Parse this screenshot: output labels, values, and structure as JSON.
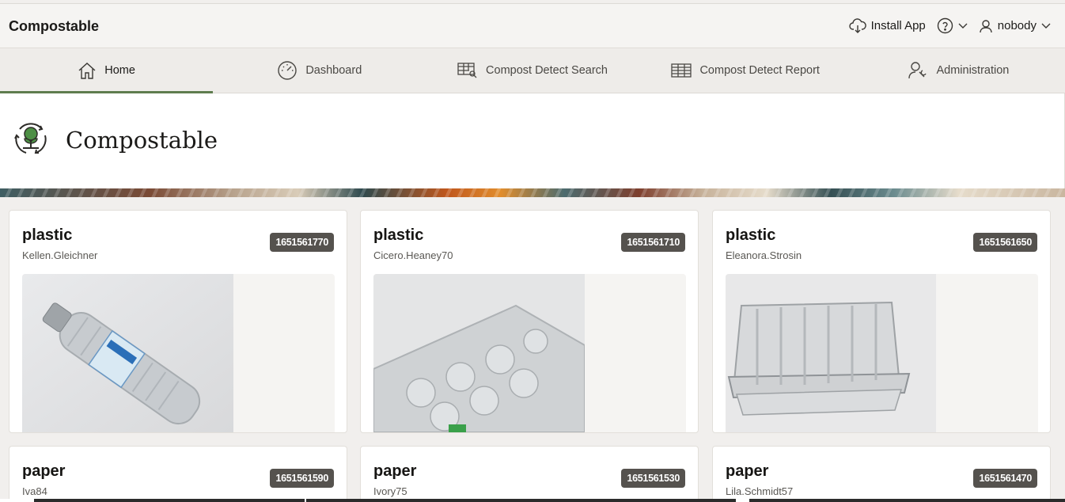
{
  "app": {
    "name": "Compostable"
  },
  "top_right": {
    "install_label": "Install App",
    "user_name": "nobody"
  },
  "nav": {
    "items": [
      {
        "label": "Home",
        "icon": "home-icon",
        "active": true
      },
      {
        "label": "Dashboard",
        "icon": "gauge-icon"
      },
      {
        "label": "Compost Detect Search",
        "icon": "table-search-icon"
      },
      {
        "label": "Compost Detect Report",
        "icon": "table-icon"
      },
      {
        "label": "Administration",
        "icon": "user-wrench-icon"
      }
    ]
  },
  "hero": {
    "title": "Compostable"
  },
  "cards": [
    {
      "title": "plastic",
      "user": "Kellen.Gleichner",
      "badge": "1651561770",
      "image": "plastic-bottle"
    },
    {
      "title": "plastic",
      "user": "Cicero.Heaney70",
      "badge": "1651561710",
      "image": "plastic-tray"
    },
    {
      "title": "plastic",
      "user": "Eleanora.Strosin",
      "badge": "1651561650",
      "image": "plastic-container"
    },
    {
      "title": "paper",
      "user": "Iva84",
      "badge": "1651561590"
    },
    {
      "title": "paper",
      "user": "Ivory75",
      "badge": "1651561530"
    },
    {
      "title": "paper",
      "user": "Lila.Schmidt57",
      "badge": "1651561470"
    }
  ],
  "colors": {
    "accent": "#5f7d4f",
    "badge": "#55524e",
    "header_bg": "#f5f4f2"
  }
}
